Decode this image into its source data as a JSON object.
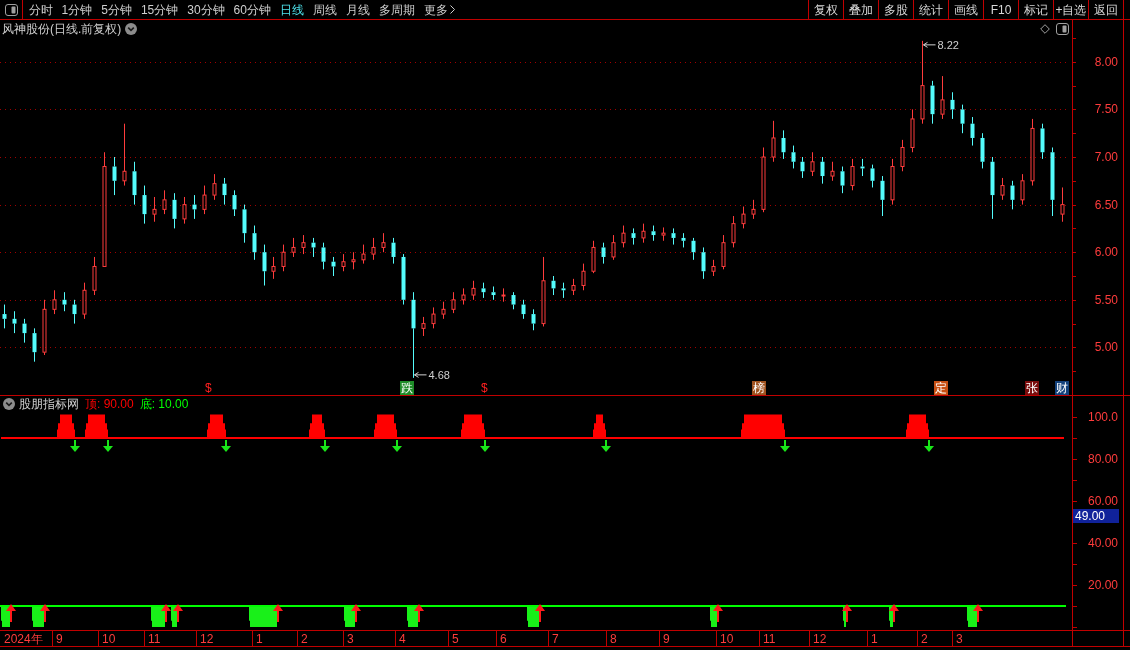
{
  "toolbar": {
    "tabs": [
      {
        "label": "分时",
        "selected": false,
        "kind": "period"
      },
      {
        "label": "1分钟",
        "selected": false,
        "kind": "period"
      },
      {
        "label": "5分钟",
        "selected": false,
        "kind": "period"
      },
      {
        "label": "15分钟",
        "selected": false,
        "kind": "period"
      },
      {
        "label": "30分钟",
        "selected": false,
        "kind": "period"
      },
      {
        "label": "60分钟",
        "selected": false,
        "kind": "period"
      },
      {
        "label": "日线",
        "selected": true,
        "kind": "period"
      },
      {
        "label": "周线",
        "selected": false,
        "kind": "period"
      },
      {
        "label": "月线",
        "selected": false,
        "kind": "period"
      },
      {
        "label": "多周期",
        "selected": false,
        "kind": "period"
      },
      {
        "label": "更多",
        "selected": false,
        "kind": "menu"
      }
    ],
    "buttons": [
      "复权",
      "叠加",
      "多股",
      "统计",
      "画线",
      "F10",
      "标记",
      "+自选",
      "返回"
    ]
  },
  "price_panel": {
    "title": "风神股份(日线.前复权)",
    "chart_data": [
      {
        "type": "candlestick",
        "ylim": [
          4.5,
          8.25
        ],
        "yticks": [
          {
            "value": 8,
            "label": "8.00"
          },
          {
            "value": 7.5,
            "label": "7.50"
          },
          {
            "value": 7,
            "label": "7.00"
          },
          {
            "value": 6.5,
            "label": "6.50"
          },
          {
            "value": 6,
            "label": "6.00"
          },
          {
            "value": 5.5,
            "label": "5.50"
          },
          {
            "value": 5,
            "label": "5.00"
          }
        ],
        "grid": true,
        "annotations": [
          "8.22",
          "4.68"
        ],
        "ohlc": [
          [
            5.35,
            5.45,
            5.2,
            5.3
          ],
          [
            5.3,
            5.38,
            5.15,
            5.25
          ],
          [
            5.25,
            5.3,
            5.05,
            5.15
          ],
          [
            5.15,
            5.2,
            4.85,
            4.95
          ],
          [
            4.95,
            5.5,
            4.92,
            5.4
          ],
          [
            5.4,
            5.6,
            5.35,
            5.5
          ],
          [
            5.5,
            5.58,
            5.38,
            5.45
          ],
          [
            5.45,
            5.5,
            5.25,
            5.35
          ],
          [
            5.35,
            5.68,
            5.3,
            5.6
          ],
          [
            5.6,
            5.95,
            5.55,
            5.85
          ],
          [
            5.85,
            7.05,
            5.85,
            6.9
          ],
          [
            6.9,
            7.0,
            6.6,
            6.75
          ],
          [
            6.75,
            7.35,
            6.7,
            6.85
          ],
          [
            6.85,
            6.95,
            6.5,
            6.6
          ],
          [
            6.6,
            6.7,
            6.3,
            6.4
          ],
          [
            6.4,
            6.58,
            6.32,
            6.45
          ],
          [
            6.45,
            6.65,
            6.4,
            6.55
          ],
          [
            6.55,
            6.62,
            6.25,
            6.35
          ],
          [
            6.35,
            6.58,
            6.3,
            6.5
          ],
          [
            6.5,
            6.6,
            6.35,
            6.45
          ],
          [
            6.45,
            6.7,
            6.4,
            6.6
          ],
          [
            6.6,
            6.82,
            6.55,
            6.72
          ],
          [
            6.72,
            6.78,
            6.5,
            6.6
          ],
          [
            6.6,
            6.65,
            6.38,
            6.45
          ],
          [
            6.45,
            6.5,
            6.1,
            6.2
          ],
          [
            6.2,
            6.28,
            5.92,
            6.0
          ],
          [
            6.0,
            6.08,
            5.65,
            5.8
          ],
          [
            5.8,
            5.95,
            5.72,
            5.85
          ],
          [
            5.85,
            6.08,
            5.8,
            6.0
          ],
          [
            6.0,
            6.15,
            5.95,
            6.05
          ],
          [
            6.05,
            6.18,
            5.98,
            6.1
          ],
          [
            6.1,
            6.15,
            5.95,
            6.05
          ],
          [
            6.05,
            6.1,
            5.82,
            5.9
          ],
          [
            5.9,
            5.95,
            5.75,
            5.85
          ],
          [
            5.85,
            5.98,
            5.8,
            5.9
          ],
          [
            5.9,
            6.0,
            5.82,
            5.92
          ],
          [
            5.92,
            6.08,
            5.88,
            5.98
          ],
          [
            5.98,
            6.15,
            5.92,
            6.05
          ],
          [
            6.05,
            6.2,
            6.0,
            6.1
          ],
          [
            6.1,
            6.15,
            5.88,
            5.95
          ],
          [
            5.95,
            5.98,
            5.45,
            5.5
          ],
          [
            5.5,
            5.58,
            4.68,
            5.2
          ],
          [
            5.2,
            5.32,
            5.12,
            5.25
          ],
          [
            5.25,
            5.42,
            5.2,
            5.35
          ],
          [
            5.35,
            5.48,
            5.3,
            5.4
          ],
          [
            5.4,
            5.58,
            5.36,
            5.5
          ],
          [
            5.5,
            5.62,
            5.45,
            5.55
          ],
          [
            5.55,
            5.7,
            5.5,
            5.62
          ],
          [
            5.62,
            5.68,
            5.52,
            5.58
          ],
          [
            5.58,
            5.64,
            5.5,
            5.55
          ],
          [
            5.55,
            5.62,
            5.48,
            5.55
          ],
          [
            5.55,
            5.58,
            5.4,
            5.45
          ],
          [
            5.45,
            5.5,
            5.3,
            5.35
          ],
          [
            5.35,
            5.4,
            5.18,
            5.25
          ],
          [
            5.25,
            5.95,
            5.22,
            5.7
          ],
          [
            5.7,
            5.75,
            5.55,
            5.62
          ],
          [
            5.62,
            5.68,
            5.52,
            5.6
          ],
          [
            5.6,
            5.72,
            5.55,
            5.65
          ],
          [
            5.65,
            5.88,
            5.6,
            5.8
          ],
          [
            5.8,
            6.12,
            5.78,
            6.05
          ],
          [
            6.05,
            6.1,
            5.88,
            5.95
          ],
          [
            5.95,
            6.18,
            5.92,
            6.1
          ],
          [
            6.1,
            6.28,
            6.05,
            6.2
          ],
          [
            6.2,
            6.25,
            6.08,
            6.15
          ],
          [
            6.15,
            6.3,
            6.1,
            6.22
          ],
          [
            6.22,
            6.28,
            6.12,
            6.18
          ],
          [
            6.18,
            6.26,
            6.12,
            6.2
          ],
          [
            6.2,
            6.25,
            6.08,
            6.15
          ],
          [
            6.15,
            6.2,
            6.05,
            6.12
          ],
          [
            6.12,
            6.15,
            5.92,
            6.0
          ],
          [
            6.0,
            6.05,
            5.72,
            5.8
          ],
          [
            5.8,
            5.92,
            5.75,
            5.85
          ],
          [
            5.85,
            6.18,
            5.82,
            6.1
          ],
          [
            6.1,
            6.38,
            6.05,
            6.3
          ],
          [
            6.3,
            6.48,
            6.25,
            6.4
          ],
          [
            6.4,
            6.55,
            6.35,
            6.45
          ],
          [
            6.45,
            7.1,
            6.42,
            7.0
          ],
          [
            7.0,
            7.38,
            6.95,
            7.2
          ],
          [
            7.2,
            7.28,
            6.98,
            7.05
          ],
          [
            7.05,
            7.12,
            6.88,
            6.95
          ],
          [
            6.95,
            7.0,
            6.78,
            6.85
          ],
          [
            6.85,
            7.05,
            6.8,
            6.95
          ],
          [
            6.95,
            7.0,
            6.72,
            6.8
          ],
          [
            6.8,
            6.95,
            6.75,
            6.85
          ],
          [
            6.85,
            6.9,
            6.62,
            6.7
          ],
          [
            6.7,
            6.98,
            6.65,
            6.9
          ],
          [
            6.9,
            6.98,
            6.8,
            6.88
          ],
          [
            6.88,
            6.92,
            6.68,
            6.75
          ],
          [
            6.75,
            6.8,
            6.38,
            6.55
          ],
          [
            6.55,
            6.98,
            6.5,
            6.9
          ],
          [
            6.9,
            7.18,
            6.85,
            7.1
          ],
          [
            7.1,
            7.5,
            7.05,
            7.4
          ],
          [
            7.4,
            8.22,
            7.35,
            7.75
          ],
          [
            7.75,
            7.8,
            7.35,
            7.45
          ],
          [
            7.45,
            7.85,
            7.4,
            7.6
          ],
          [
            7.6,
            7.68,
            7.4,
            7.5
          ],
          [
            7.5,
            7.55,
            7.25,
            7.35
          ],
          [
            7.35,
            7.42,
            7.12,
            7.2
          ],
          [
            7.2,
            7.25,
            6.88,
            6.95
          ],
          [
            6.95,
            7.0,
            6.35,
            6.6
          ],
          [
            6.6,
            6.78,
            6.55,
            6.7
          ],
          [
            6.7,
            6.75,
            6.45,
            6.55
          ],
          [
            6.55,
            6.82,
            6.5,
            6.75
          ],
          [
            6.75,
            7.4,
            6.7,
            7.3
          ],
          [
            7.3,
            7.35,
            6.98,
            7.05
          ],
          [
            7.05,
            7.1,
            6.38,
            6.55
          ],
          [
            6.4,
            6.68,
            6.32,
            6.5
          ]
        ]
      }
    ],
    "events": [
      {
        "label": "$",
        "kind": "text",
        "color": "#ff2020"
      },
      {
        "label": "跌",
        "kind": "tag",
        "color": "#1e8c28"
      },
      {
        "label": "$",
        "kind": "text",
        "color": "#ff2020"
      },
      {
        "label": "榜",
        "kind": "tag",
        "color": "#a0521e"
      },
      {
        "label": "定",
        "kind": "tag",
        "color": "#c85014"
      },
      {
        "label": "张",
        "kind": "tag",
        "color": "#7a0c0c"
      },
      {
        "label": "财",
        "kind": "tag",
        "color": "#12407a"
      }
    ]
  },
  "indicator_panel": {
    "title": "股朋指标网",
    "thresholds": [
      {
        "label": "顶: 90.00",
        "color": "#ff0000"
      },
      {
        "label": "底: 10.00",
        "color": "#00ff00"
      }
    ],
    "axis_labels": [
      "100.0",
      "80.00",
      "60.00",
      "40.00",
      "20.00"
    ],
    "current_value": "49.00"
  },
  "time_axis": {
    "labels": [
      "2024年",
      "9",
      "10",
      "11",
      "12",
      "1",
      "2",
      "3",
      "4",
      "5",
      "6",
      "7",
      "8",
      "9",
      "10",
      "11",
      "12",
      "1",
      "2",
      "3"
    ]
  }
}
